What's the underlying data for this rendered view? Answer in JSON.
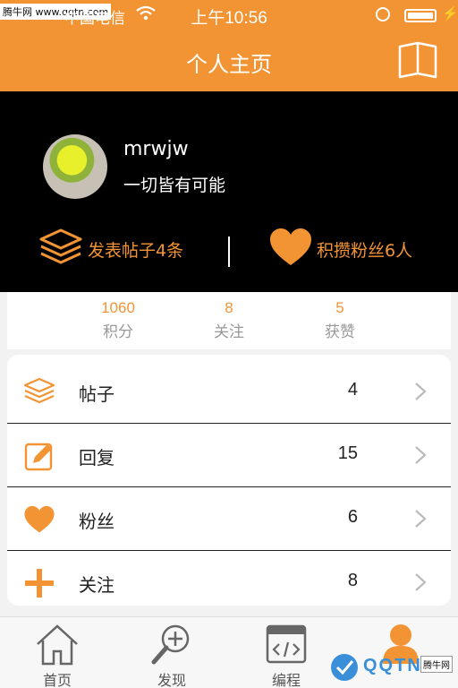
{
  "status_bar": {
    "watermark": "腾牛网 www.qqtn.com",
    "carrier": "中国电信",
    "time": "上午10:56"
  },
  "nav": {
    "title": "个人主页"
  },
  "profile": {
    "username": "mrwjw",
    "signature": "一切皆有可能",
    "posts_text": "发表帖子4条",
    "fans_text": "积攒粉丝6人"
  },
  "metrics": [
    {
      "value": "1060",
      "label": "积分"
    },
    {
      "value": "8",
      "label": "关注"
    },
    {
      "value": "5",
      "label": "获赞"
    }
  ],
  "menu": [
    {
      "label": "帖子",
      "count": "4",
      "icon": "layers-icon"
    },
    {
      "label": "回复",
      "count": "15",
      "icon": "edit-icon"
    },
    {
      "label": "粉丝",
      "count": "6",
      "icon": "heart-icon"
    },
    {
      "label": "关注",
      "count": "8",
      "icon": "plus-icon"
    }
  ],
  "tabbar": [
    {
      "label": "首页",
      "icon": "home-icon"
    },
    {
      "label": "发现",
      "icon": "search-icon"
    },
    {
      "label": "编程",
      "icon": "code-icon"
    },
    {
      "label": "",
      "icon": "user-icon",
      "active": true
    }
  ],
  "footer_watermark": {
    "logo": "QQTN",
    "corner": "腾牛网"
  },
  "colors": {
    "accent": "#f39434",
    "header_bg": "#000000"
  }
}
